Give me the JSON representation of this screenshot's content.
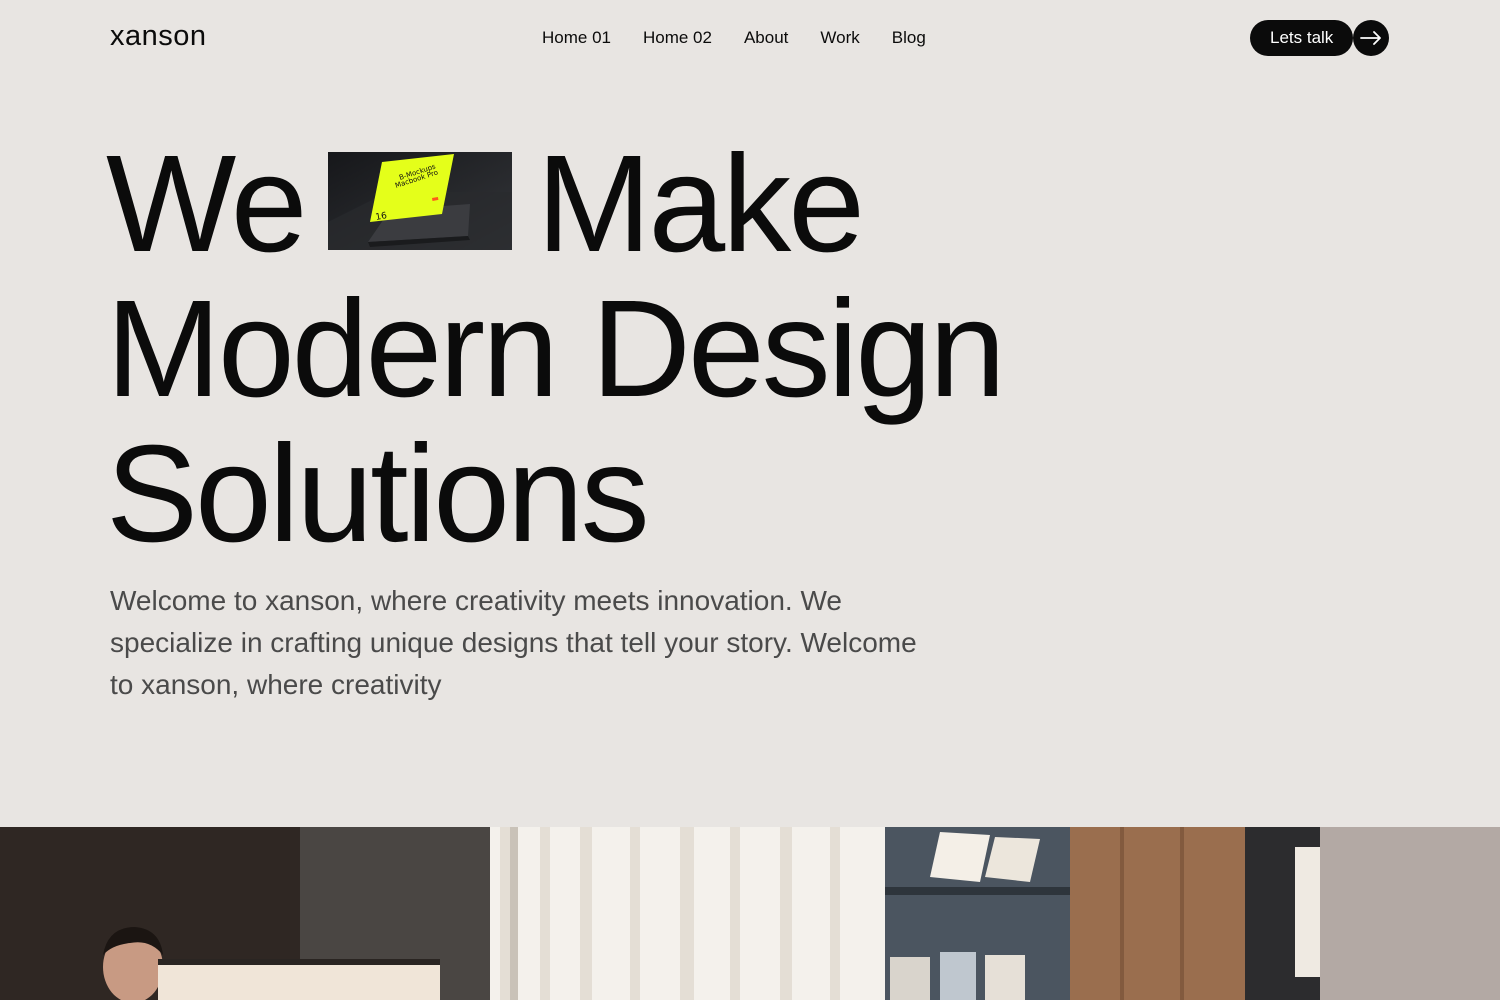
{
  "header": {
    "logo": "xanson",
    "nav": [
      "Home 01",
      "Home 02",
      "About",
      "Work",
      "Blog"
    ],
    "cta_label": "Lets talk",
    "cta_icon": "arrow-right-icon"
  },
  "hero": {
    "line1_a": "We",
    "line1_b": "Make",
    "line2": "Modern Design",
    "line3": "Solutions",
    "thumb": {
      "title_line1": "B-Mockups",
      "title_line2": "Macbook Pro",
      "number": "16"
    },
    "intro": "Welcome to xanson, where creativity meets innovation. We specialize in crafting unique designs that tell your story. Welcome to xanson, where creativity"
  },
  "colors": {
    "background": "#e8e5e2",
    "text": "#0b0b0b",
    "muted": "#4a4a4a",
    "accent_lime": "#e4ff1a"
  }
}
